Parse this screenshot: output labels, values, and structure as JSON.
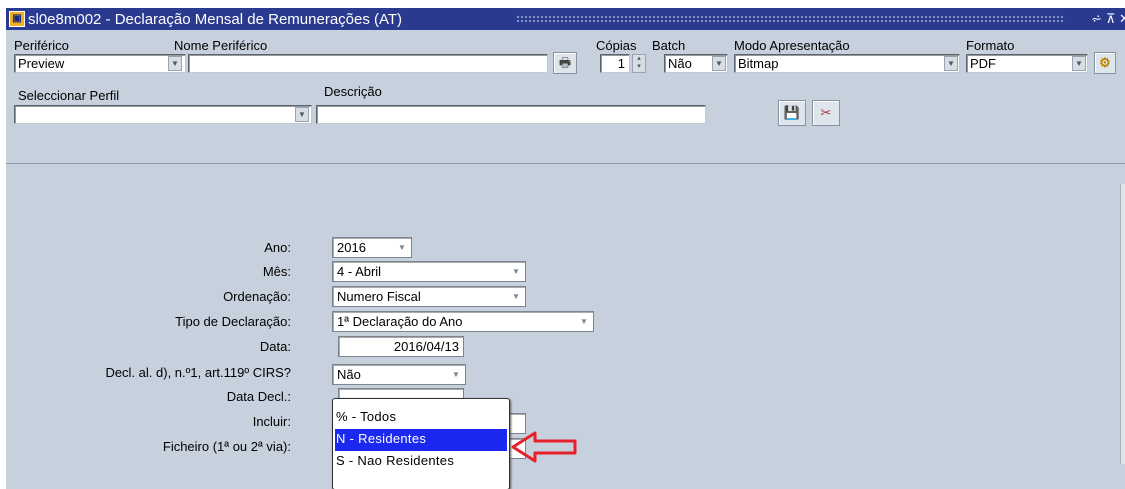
{
  "window": {
    "title": "sl0e8m002 - Declaração Mensal de Remunerações (AT)",
    "app_icon": "oracle-forms-icon",
    "controls": [
      "minimize-icon",
      "maximize-icon",
      "close-icon"
    ]
  },
  "print_options": {
    "periferico_label": "Periférico",
    "periferico_value": "Preview",
    "nome_periferico_label": "Nome Periférico",
    "nome_periferico_value": "",
    "copias_label": "Cópias",
    "copias_value": "1",
    "batch_label": "Batch",
    "batch_value": "Não",
    "modo_label": "Modo Apresentação",
    "modo_value": "Bitmap",
    "formato_label": "Formato",
    "formato_value": "PDF",
    "perfil_label": "Seleccionar Perfil",
    "perfil_value": "",
    "descricao_label": "Descrição",
    "descricao_value": ""
  },
  "form": {
    "ano_label": "Ano:",
    "ano_value": "2016",
    "mes_label": "Mês:",
    "mes_value": "4 - Abril",
    "ordenacao_label": "Ordenação:",
    "ordenacao_value": "Numero Fiscal",
    "tipo_label": "Tipo de Declaração:",
    "tipo_value": "1ª Declaração do Ano",
    "data_label": "Data:",
    "data_value": "2016/04/13",
    "decl_label": "Decl. al. d), n.º1, art.119º CIRS?",
    "decl_value": "Não",
    "data_decl_label": "Data Decl.:",
    "incluir_label": "Incluir:",
    "ficheiro_label": "Ficheiro (1ª ou 2ª via):"
  },
  "dropdown": {
    "options": [
      "% - Todos",
      "N - Residentes",
      "S - Nao Residentes"
    ],
    "selected_index": 1
  },
  "colors": {
    "titlebar": "#2a3b8f",
    "panel": "#c7d1dd",
    "selection": "#1a28f0",
    "annotation_arrow": "#e8202a"
  }
}
